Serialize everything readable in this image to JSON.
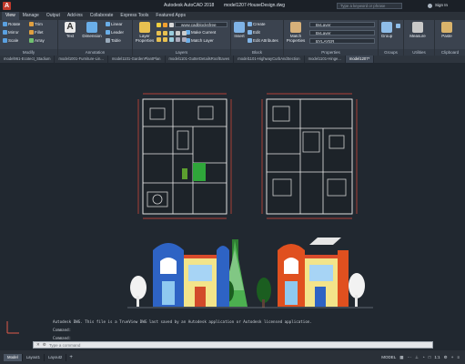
{
  "app": {
    "title": "Autodesk AutoCAD 2018",
    "file": "model1207-HouseDesign.dwg",
    "search_placeholder": "Type a keyword or phrase",
    "signin": "Sign In"
  },
  "ribbon_tabs": [
    "View",
    "Manage",
    "Output",
    "Add-ins",
    "Collaborate",
    "Express Tools",
    "Featured Apps"
  ],
  "panels": {
    "modify": {
      "title": "Modify",
      "tools": [
        "Rotate",
        "Trim",
        "Mirror",
        "Fillet",
        "Scale",
        "Array"
      ]
    },
    "annotation": {
      "title": "Annotation",
      "text": "Text",
      "dimension": "Dimension",
      "tools": [
        "Linear",
        "Leader",
        "Table"
      ]
    },
    "layers": {
      "title": "Layers",
      "layer_properties": "Layer Properties",
      "current": "www.cadblocksfree",
      "make_current": "Make Current",
      "match_layer": "Match Layer"
    },
    "block": {
      "title": "Block",
      "insert": "Insert",
      "create": "Create",
      "edit": "Edit",
      "edit_attributes": "Edit Attributes"
    },
    "properties": {
      "title": "Properties",
      "match": "Match Properties",
      "bylayer1": "ByLayer",
      "bylayer2": "ByLayer",
      "bylayer3": "BYLAYER"
    },
    "groups": {
      "title": "Groups",
      "group": "Group"
    },
    "utilities": {
      "title": "Utilities",
      "measure": "Measure"
    },
    "clipboard": {
      "title": "Clipboard",
      "paste": "Paste"
    }
  },
  "doc_tabs": [
    "model961-Ecotect_Stadium",
    "model1001-Furniture-Lin...",
    "model1101-GardenPlantPlan",
    "model1101-GutterDetailsRoofEaves",
    "model1101-HighwayCurbAndSection",
    "model1101-Hinge...",
    "model1207*"
  ],
  "command": {
    "history": [
      "Autodesk DWG.  This file is a TrueView DWG last saved by an Autodesk application or Autodesk licensed application.",
      "Command:",
      "Command:"
    ],
    "placeholder": "Type a command"
  },
  "status": {
    "layout_tabs": [
      "Model",
      "Layout1",
      "Layout2"
    ],
    "model_label": "MODEL",
    "scale": "1:1"
  }
}
